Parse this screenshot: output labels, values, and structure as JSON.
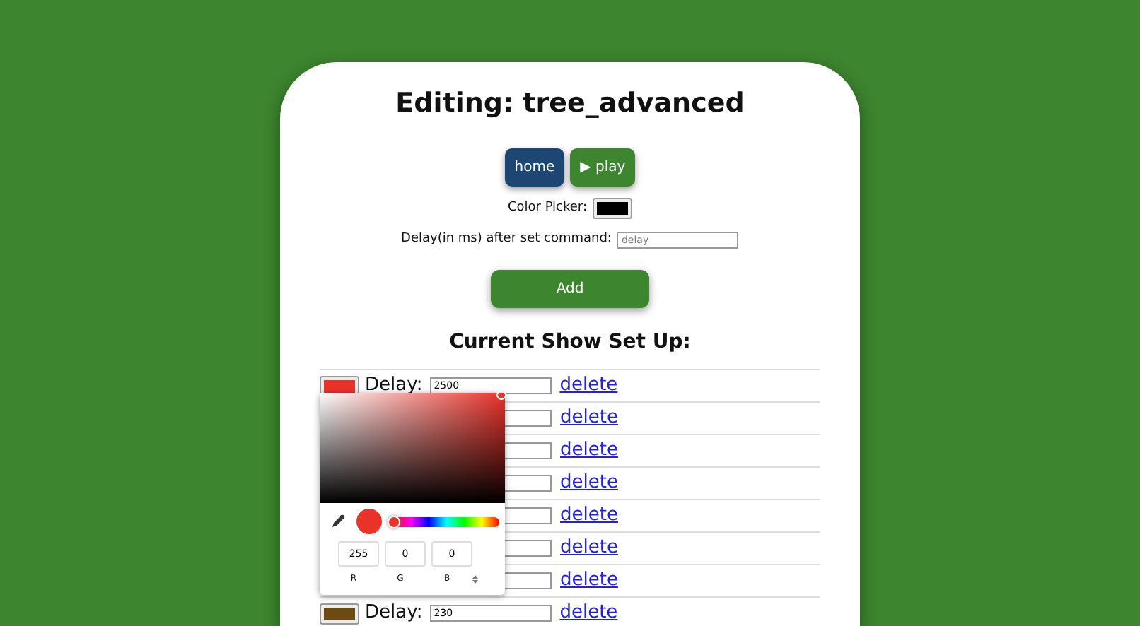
{
  "title": "Editing: tree_advanced",
  "buttons": [
    {
      "kind": "home",
      "label": "home"
    },
    {
      "kind": "play",
      "label": "play",
      "icon": "▶"
    }
  ],
  "color_picker": {
    "label": "Color Picker:",
    "color": "#000000"
  },
  "delay_field": {
    "label": "Delay(in ms) after set command:",
    "placeholder": "delay"
  },
  "add_button": "Add",
  "section_title": "Current Show Set Up:",
  "rows": [
    {
      "color": "#e8322a",
      "label": "Delay:",
      "delay": "2500",
      "action": "delete"
    },
    {
      "action": "delete"
    },
    {
      "action": "delete"
    },
    {
      "action": "delete"
    },
    {
      "action": "delete"
    },
    {
      "action": "delete"
    },
    {
      "action": "delete"
    },
    {
      "color": "#6b4a14",
      "label": "Delay:",
      "delay": "230",
      "action": "delete"
    }
  ],
  "popup": {
    "color": "#e8322a",
    "hue": {
      "level": 0
    },
    "channels": [
      {
        "label": "R",
        "value": "255"
      },
      {
        "label": "G",
        "value": "0"
      },
      {
        "label": "B",
        "value": "0"
      }
    ]
  }
}
